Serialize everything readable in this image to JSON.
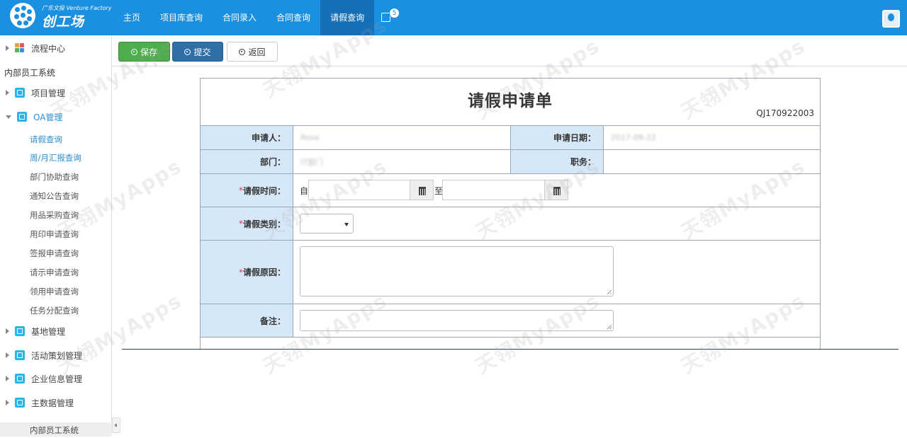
{
  "logo": {
    "sub": "广东文投 Venture Factory",
    "main": "创工场"
  },
  "nav": {
    "items": [
      {
        "label": "主页",
        "active": false
      },
      {
        "label": "项目库查询",
        "active": false
      },
      {
        "label": "合同录入",
        "active": false
      },
      {
        "label": "合同查询",
        "active": false
      },
      {
        "label": "请假查询",
        "active": true
      }
    ],
    "notification_count": "5"
  },
  "sidebar": {
    "flow_center": "流程中心",
    "system_title": "内部员工系统",
    "groups": {
      "project": "项目管理",
      "oa": "OA管理",
      "base": "基地管理",
      "activity": "活动策划管理",
      "enterprise": "企业信息管理",
      "master": "主数据管理"
    },
    "oa_items": [
      "请假查询",
      "周/月汇报查询",
      "部门协助查询",
      "通知公告查询",
      "用品采购查询",
      "用印申请查询",
      "签报申请查询",
      "请示申请查询",
      "领用申请查询",
      "任务分配查询"
    ],
    "footer": "内部员工系统"
  },
  "toolbar": {
    "save": "保存",
    "submit": "提交",
    "back": "返回"
  },
  "form": {
    "title": "请假申请单",
    "number": "QJ170922003",
    "applicant_label": "申请人：",
    "applicant_value": "Rose",
    "apply_date_label": "申请日期：",
    "apply_date_value": "2017-09-22",
    "dept_label": "部门：",
    "dept_value": "IT部门",
    "position_label": "职务：",
    "position_value": "",
    "leave_time_label": "请假时间：",
    "from_text": "自",
    "to_text": "至",
    "leave_type_label": "请假类别：",
    "reason_label": "请假原因：",
    "remark_label": "备注：",
    "required_mark": "*"
  },
  "watermark": "天翎MyApps"
}
